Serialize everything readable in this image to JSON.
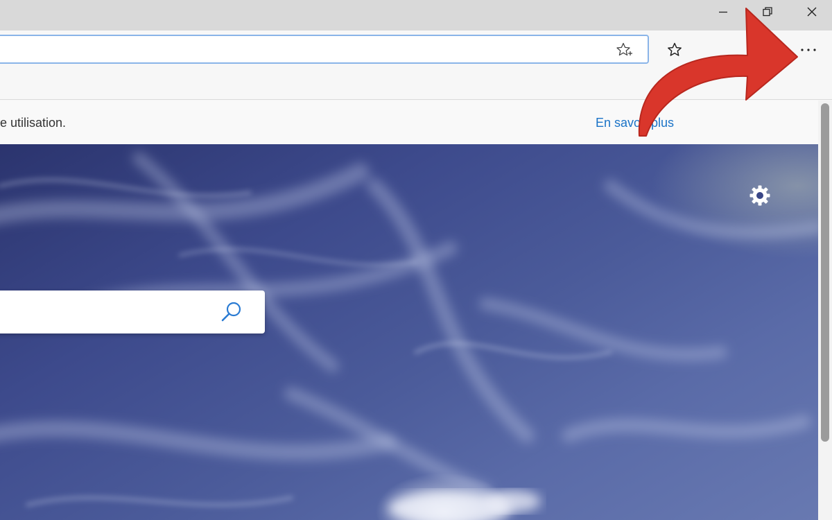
{
  "window_controls": {
    "minimize_icon": "minimize-icon",
    "restore_icon": "restore-icon",
    "close_icon": "close-icon"
  },
  "address_bar": {
    "value": "",
    "placeholder": ""
  },
  "toolbar": {
    "add_favorite_icon": "star-plus-icon",
    "favorites_icon": "star-icon",
    "more_label": "···"
  },
  "notice": {
    "text": "e utilisation.",
    "link": "En savoir plus"
  },
  "page": {
    "settings_icon": "gear-icon",
    "search_value": "",
    "search_icon": "search-icon"
  },
  "annotation": {
    "arrow_color": "#d9362b"
  },
  "colors": {
    "accent_blue": "#1a73c7",
    "sky_dark": "#2b346e",
    "sky_light": "#6879b1"
  }
}
